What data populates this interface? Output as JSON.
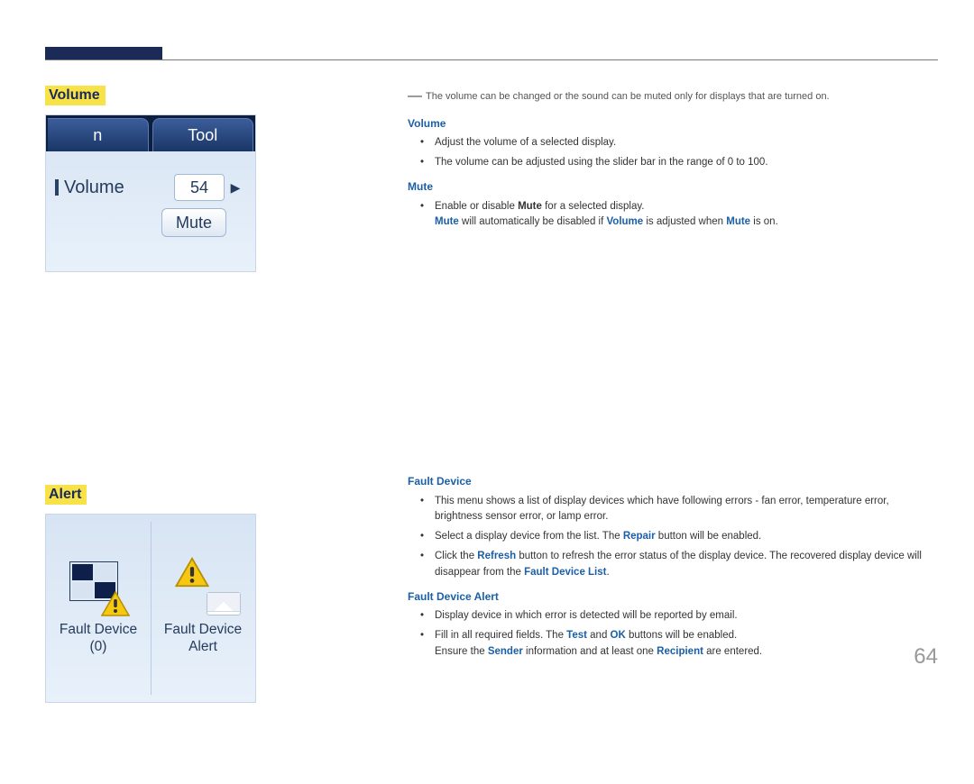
{
  "sections": {
    "volume": {
      "title": "Volume"
    },
    "alert": {
      "title": "Alert"
    }
  },
  "screenshot_volume": {
    "tab_left": "n",
    "tab_right": "Tool",
    "label": "Volume",
    "value": "54",
    "mute_btn": "Mute"
  },
  "screenshot_alert": {
    "cell1_line1": "Fault Device",
    "cell1_line2": "(0)",
    "cell2_line1": "Fault Device",
    "cell2_line2": "Alert"
  },
  "right": {
    "note": "The volume can be changed or the sound can be muted only for displays that are turned on.",
    "volume": {
      "head": "Volume",
      "b1": "Adjust the volume of a selected display.",
      "b2": "The volume can be adjusted using the slider bar in the range of 0 to 100."
    },
    "mute": {
      "head": "Mute",
      "b1_pre": "Enable or disable ",
      "b1_bold": "Mute",
      "b1_post": " for a selected display.",
      "b1s_1": "Mute",
      "b1s_2": " will automatically be disabled if ",
      "b1s_3": "Volume",
      "b1s_4": " is adjusted when ",
      "b1s_5": "Mute",
      "b1s_6": " is on."
    },
    "fault_device": {
      "head": "Fault Device",
      "b1": "This menu shows a list of display devices which have following errors - fan error, temperature error, brightness sensor error, or lamp error.",
      "b2_pre": "Select a display device from the list. The ",
      "b2_bold": "Repair",
      "b2_post": " button will be enabled.",
      "b3_pre": "Click the ",
      "b3_bold": "Refresh",
      "b3_mid": " button to refresh the error status of the display device. The recovered display device will disappear from the ",
      "b3_bold2": "Fault Device List",
      "b3_post": "."
    },
    "fault_alert": {
      "head": "Fault Device Alert",
      "b1": "Display device in which error is detected will be reported by email.",
      "b2_pre": "Fill in all required fields. The ",
      "b2_bold": "Test",
      "b2_mid": " and ",
      "b2_bold2": "OK",
      "b2_post": " buttons will be enabled.",
      "b2s_pre": "Ensure the ",
      "b2s_bold": "Sender",
      "b2s_mid": " information and at least one ",
      "b2s_bold2": "Recipient",
      "b2s_post": " are entered."
    }
  },
  "page_number": "64"
}
